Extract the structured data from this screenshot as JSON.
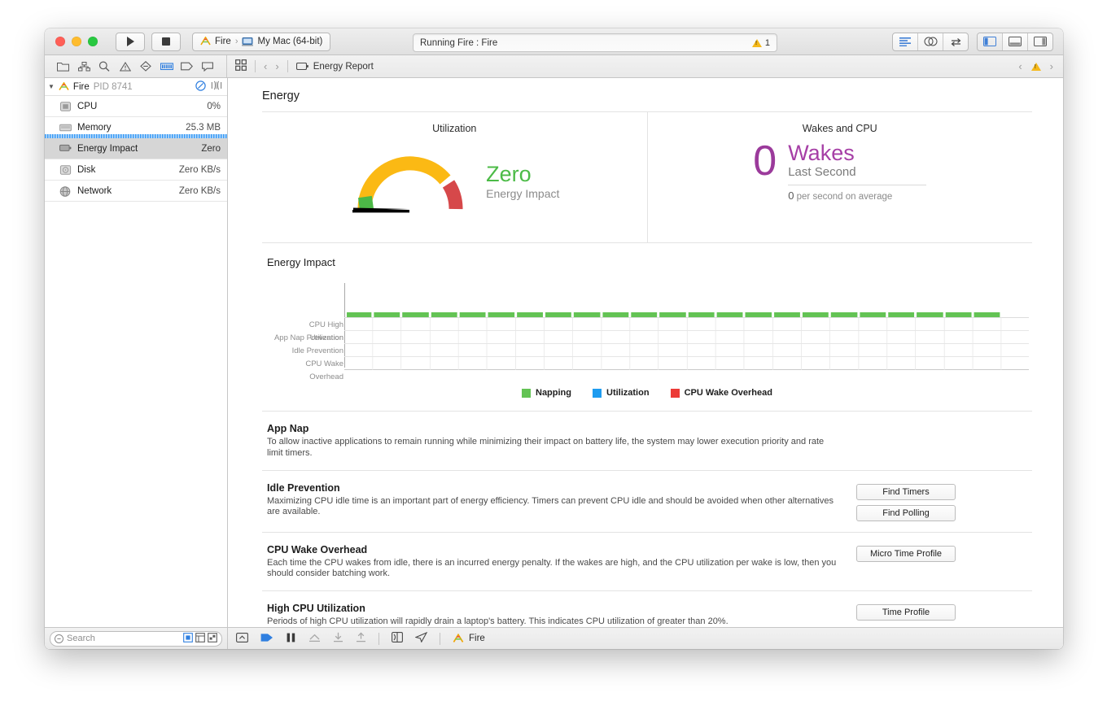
{
  "window": {
    "titlebar": {
      "run_button": "run-icon",
      "stop_button": "stop-icon",
      "scheme_app": "Fire",
      "scheme_separator": "›",
      "scheme_device": "My Mac (64-bit)",
      "status_text": "Running Fire : Fire",
      "warning_count": "1"
    },
    "right_toolbar": {
      "items": [
        "standard-editor-icon",
        "assistant-editor-icon",
        "version-editor-icon",
        "toggle-navigator-icon",
        "toggle-debug-icon",
        "toggle-utilities-icon"
      ]
    }
  },
  "navbar": {
    "icons": [
      "folder-icon",
      "hierarchy-icon",
      "search-icon",
      "warning-icon",
      "breakpoint-icon",
      "debug-navigator-icon",
      "tag-icon",
      "comment-icon"
    ],
    "grid_icon": "grid-icon",
    "back": "‹",
    "forward": "›",
    "breadcrumb_icon": "battery-icon",
    "breadcrumb_label": "Energy Report",
    "right_back": "‹",
    "right_warning": "warning-icon",
    "right_forward": "›"
  },
  "sidebar": {
    "header": {
      "disclosure": "▼",
      "app_icon": "instruments-icon",
      "name": "Fire",
      "pid_label": "PID 8741",
      "icons": [
        "pause-circle-icon",
        "view-toggle-icon"
      ]
    },
    "rows": [
      {
        "icon": "cpu-icon",
        "label": "CPU",
        "value": "0%",
        "selected": false,
        "gauge": false
      },
      {
        "icon": "memory-icon",
        "label": "Memory",
        "value": "25.3 MB",
        "selected": false,
        "gauge": true
      },
      {
        "icon": "battery-icon",
        "label": "Energy Impact",
        "value": "Zero",
        "selected": true,
        "gauge": false
      },
      {
        "icon": "disk-icon",
        "label": "Disk",
        "value": "Zero KB/s",
        "selected": false,
        "gauge": false
      },
      {
        "icon": "network-icon",
        "label": "Network",
        "value": "Zero KB/s",
        "selected": false,
        "gauge": false
      }
    ],
    "footer": {
      "search_icon": "search-icon",
      "search_placeholder": "Search",
      "filter_icons": [
        "filter-all-icon",
        "filter-range-icon",
        "filter-scope-icon"
      ]
    }
  },
  "main": {
    "page_title": "Energy",
    "utilization": {
      "panel_title": "Utilization",
      "gauge_value": "Zero",
      "gauge_caption": "Energy Impact",
      "gauge_colors": {
        "low": "#4cb847",
        "mid": "#fbb914",
        "high": "#d6484a",
        "needle": "#000000"
      },
      "value_color": "#4cbb47"
    },
    "wakes": {
      "panel_title": "Wakes and CPU",
      "count": "0",
      "unit": "Wakes",
      "period": "Last Second",
      "average_value": "0",
      "average_label": "per second on average",
      "accent_color": "#a63fa6"
    },
    "chart_data": {
      "type": "heatmap",
      "title": "Energy Impact",
      "rows": [
        "CPU High Utilization",
        "App Nap Prevention",
        "Idle Prevention",
        "CPU Wake Overhead"
      ],
      "columns": 24,
      "filled_columns": 23,
      "bar_series": "Napping",
      "bar_color": "#63c354",
      "grid": true,
      "legend_position": "bottom",
      "legend": [
        {
          "label": "Napping",
          "color": "#63c354"
        },
        {
          "label": "Utilization",
          "color": "#1e9cf0"
        },
        {
          "label": "CPU Wake Overhead",
          "color": "#ec3b37"
        }
      ]
    },
    "sections": [
      {
        "title": "App Nap",
        "body": "To allow inactive applications to remain running while minimizing their impact on battery life, the system may lower execution priority and rate limit timers.",
        "buttons": []
      },
      {
        "title": "Idle Prevention",
        "body": "Maximizing CPU idle time is an important part of energy efficiency.  Timers can prevent CPU idle and should be avoided when other alternatives are available.",
        "buttons": [
          "Find Timers",
          "Find Polling"
        ]
      },
      {
        "title": "CPU Wake Overhead",
        "body": "Each time the CPU wakes from idle, there is an incurred energy penalty.  If the wakes are high, and the CPU utilization per wake is low, then you should consider batching work.",
        "buttons": [
          "Micro Time Profile"
        ]
      },
      {
        "title": "High CPU Utilization",
        "body": "Periods of high CPU utilization will rapidly drain a laptop's battery. This indicates CPU utilization of greater than 20%.",
        "buttons": [
          "Time Profile"
        ]
      }
    ]
  },
  "debugbar": {
    "icons": [
      "hide-debug-icon",
      "continue-icon",
      "pause-icon",
      "step-over-icon",
      "step-into-icon",
      "step-out-icon",
      "view-debug-icon",
      "location-icon"
    ],
    "process_icon": "instruments-icon",
    "process_label": "Fire"
  }
}
